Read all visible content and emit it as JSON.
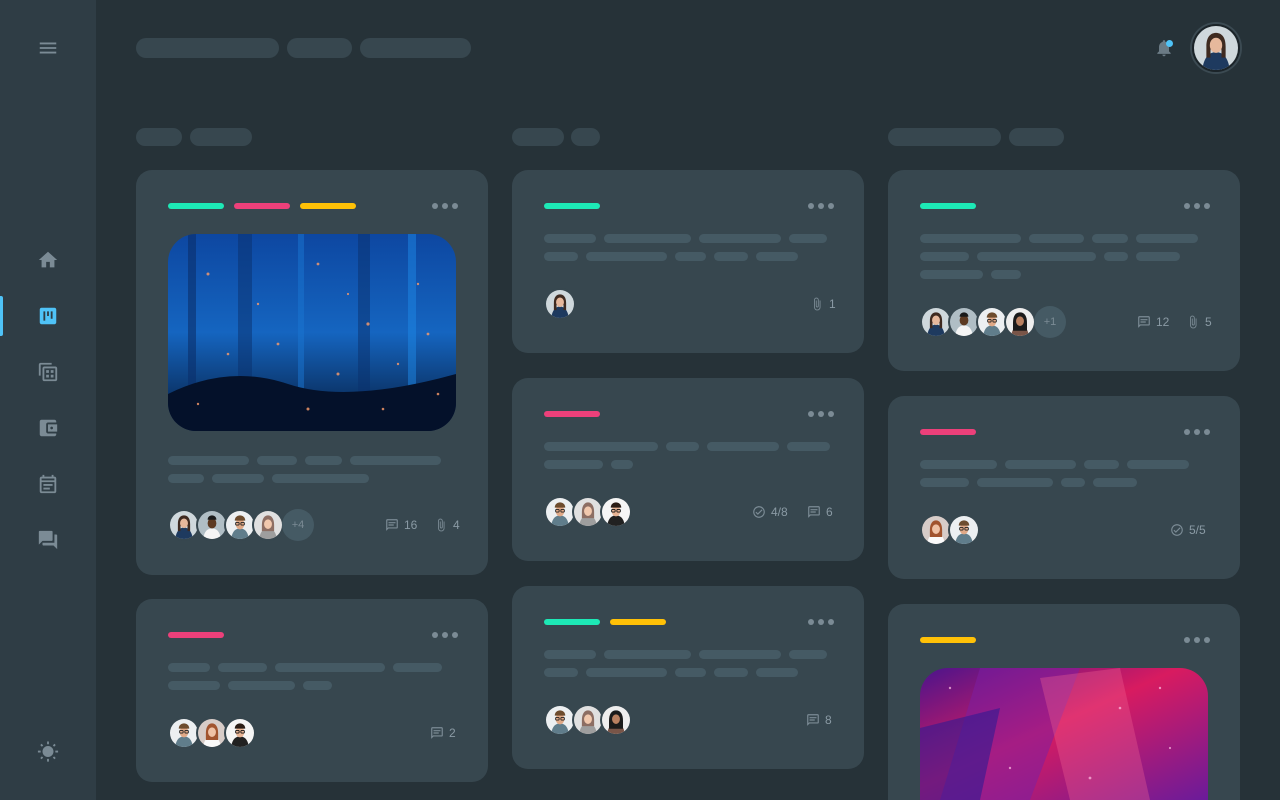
{
  "sidebar": {
    "items": [
      {
        "name": "menu",
        "icon": "menu-icon"
      },
      {
        "name": "home",
        "icon": "home-icon"
      },
      {
        "name": "board",
        "icon": "board-icon",
        "active": true
      },
      {
        "name": "table",
        "icon": "table-icon"
      },
      {
        "name": "wallet",
        "icon": "wallet-icon"
      },
      {
        "name": "calendar",
        "icon": "calendar-icon"
      },
      {
        "name": "chat",
        "icon": "chat-icon"
      },
      {
        "name": "theme",
        "icon": "sun-icon"
      }
    ]
  },
  "header": {
    "notifications": "bell-icon",
    "notification_dot": true
  },
  "colors": {
    "teal": "#1de9b6",
    "pink": "#ec407a",
    "yellow": "#ffc107",
    "accent": "#4fc3f7"
  },
  "cards": {
    "c1": {
      "comments": "16",
      "attachments": "4",
      "extra_members": "+4"
    },
    "c2": {
      "comments": "2"
    },
    "c3": {
      "attachments": "1"
    },
    "c4": {
      "checklist": "4/8",
      "comments": "6"
    },
    "c5": {
      "comments": "8"
    },
    "c6": {
      "comments": "12",
      "attachments": "5",
      "extra_members": "+1"
    },
    "c7": {
      "checklist": "5/5"
    }
  }
}
